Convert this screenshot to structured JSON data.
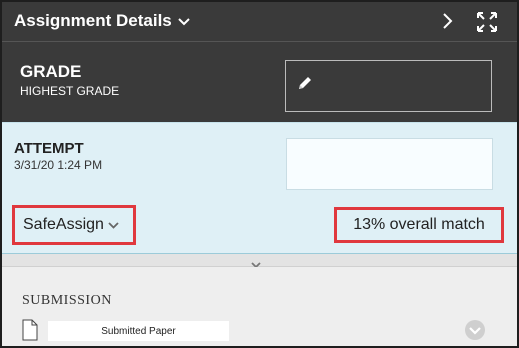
{
  "header": {
    "title": "Assignment Details",
    "icons": [
      "chevron-down-icon",
      "chevron-right-icon",
      "expand-icon"
    ]
  },
  "grade": {
    "label": "GRADE",
    "sublabel": "HIGHEST GRADE",
    "value": "",
    "edit_icon": "pencil-icon"
  },
  "attempt": {
    "label": "ATTEMPT",
    "date": "3/31/20 1:24 PM",
    "grade_value": ""
  },
  "safeassign": {
    "label": "SafeAssign",
    "match": "13% overall match"
  },
  "submission": {
    "label": "SUBMISSION",
    "file_name": "Submitted Paper"
  },
  "colors": {
    "header_bg": "#3a3a3a",
    "attempt_bg": "#dff0f6",
    "highlight": "#e0383e",
    "submission_bg": "#eeeeee"
  }
}
